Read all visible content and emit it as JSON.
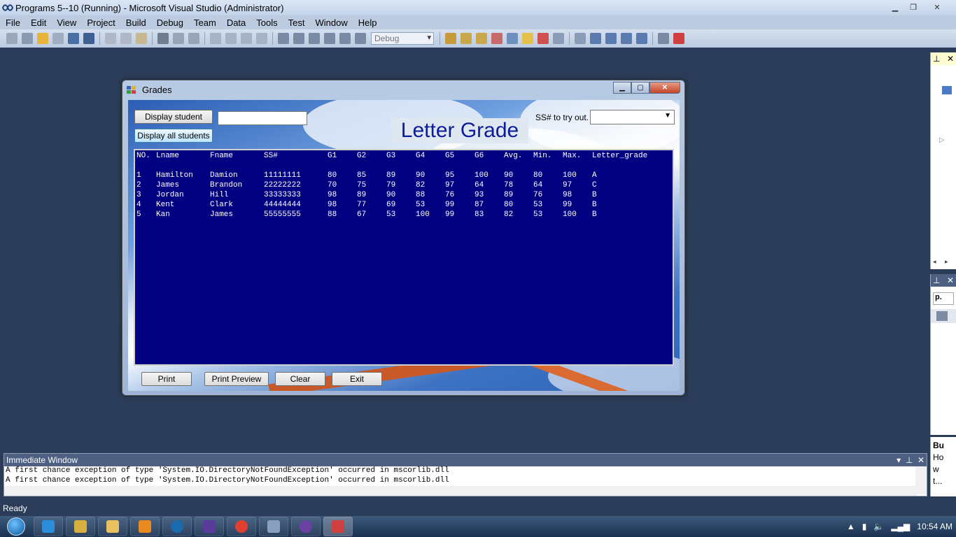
{
  "vs": {
    "title": "Programs 5--10 (Running) - Microsoft Visual Studio (Administrator)",
    "menu": [
      "File",
      "Edit",
      "View",
      "Project",
      "Build",
      "Debug",
      "Team",
      "Data",
      "Tools",
      "Test",
      "Window",
      "Help"
    ],
    "config": "Debug",
    "status": "Ready"
  },
  "grades": {
    "window_title": "Grades",
    "display_student_label": "Display student",
    "display_all_label": "Display all students",
    "heading": "Letter Grade",
    "ss_label": "SS# to try out.",
    "student_input_value": "",
    "ss_select_value": "",
    "print_label": "Print",
    "print_preview_label": "Print Preview",
    "clear_label": "Clear",
    "exit_label": "Exit",
    "columns": [
      "NO.",
      "Lname",
      "Fname",
      "SS#",
      "G1",
      "G2",
      "G3",
      "G4",
      "G5",
      "G6",
      "Avg.",
      "Min.",
      "Max.",
      "Letter_grade"
    ],
    "rows": [
      [
        "1",
        "Hamilton",
        "Damion",
        "11111111",
        "80",
        "85",
        "89",
        "90",
        "95",
        "100",
        "90",
        "80",
        "100",
        "A"
      ],
      [
        "2",
        "James",
        "Brandon",
        "22222222",
        "70",
        "75",
        "79",
        "82",
        "97",
        "64",
        "78",
        "64",
        "97",
        "C"
      ],
      [
        "3",
        "Jordan",
        "Hill",
        "33333333",
        "98",
        "89",
        "90",
        "88",
        "76",
        "93",
        "89",
        "76",
        "98",
        "B"
      ],
      [
        "4",
        "Kent",
        "Clark",
        "44444444",
        "98",
        "77",
        "69",
        "53",
        "99",
        "87",
        "80",
        "53",
        "99",
        "B"
      ],
      [
        "5",
        "Kan",
        "James",
        "55555555",
        "88",
        "67",
        "53",
        "100",
        "99",
        "83",
        "82",
        "53",
        "100",
        "B"
      ]
    ]
  },
  "immediate": {
    "title": "Immediate Window",
    "lines": [
      "A first chance exception of type 'System.IO.DirectoryNotFoundException' occurred in mscorlib.dll",
      "A first chance exception of type 'System.IO.DirectoryNotFoundException' occurred in mscorlib.dll"
    ]
  },
  "side": {
    "mid_select": "p.",
    "bottom_lines": [
      "Bu",
      "Ho",
      "w",
      "t..."
    ]
  },
  "taskbar": {
    "clock": "10:54 AM"
  },
  "colors": {
    "listbox_bg": "#000080",
    "heading_text": "#0b1d9b"
  }
}
